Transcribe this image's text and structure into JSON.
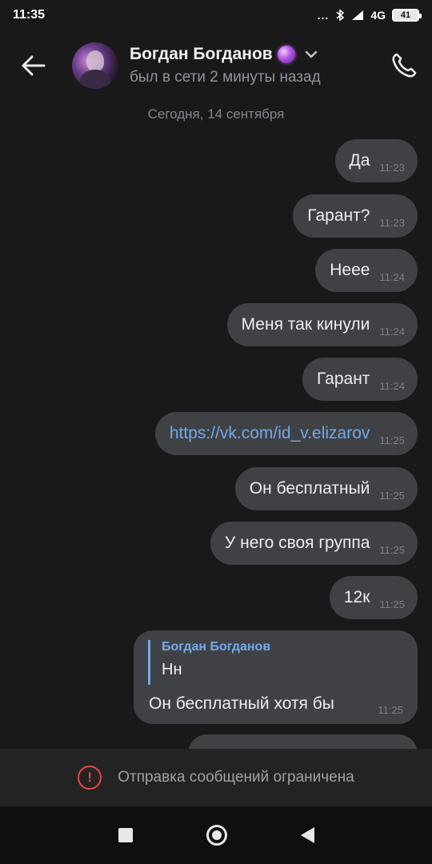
{
  "status_bar": {
    "time": "11:35",
    "dots": "...",
    "network": "4G",
    "battery": "41"
  },
  "header": {
    "contact_name": "Богдан Богданов",
    "status": "был в сети 2 минуты назад",
    "name_badge_icon": "crystal-ball-icon"
  },
  "date_separator": "Сегодня, 14 сентября",
  "messages": [
    {
      "text": "Да",
      "time": "11:23"
    },
    {
      "text": "Гарант?",
      "time": "11:23"
    },
    {
      "text": "Неее",
      "time": "11:24"
    },
    {
      "text": "Меня так кинули",
      "time": "11:24"
    },
    {
      "text": "Гарант",
      "time": "11:24"
    },
    {
      "text": "https://vk.com/id_v.elizarov",
      "time": "11:25",
      "is_link": true
    },
    {
      "text": "Он бесплатный",
      "time": "11:25"
    },
    {
      "text": "У него своя группа",
      "time": "11:25"
    },
    {
      "text": "12к",
      "time": "11:25"
    }
  ],
  "reply_message": {
    "quote_author": "Богдан Богданов",
    "quote_text": "Нн",
    "text": "Он бесплатный хотя бы",
    "time": "11:25"
  },
  "restricted_banner": {
    "icon": "!",
    "text": "Отправка сообщений ограничена"
  },
  "colors": {
    "background": "#19191a",
    "bubble": "#404144",
    "link": "#71aaeb",
    "alert": "#e64646"
  }
}
